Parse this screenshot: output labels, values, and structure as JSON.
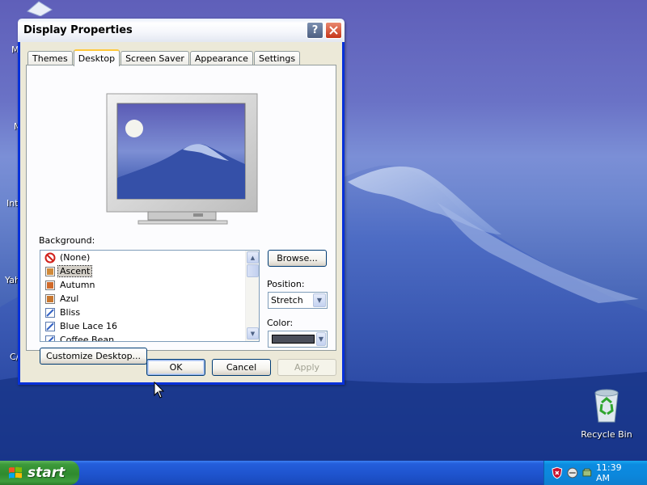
{
  "desktop": {
    "icons_partial": [
      "M",
      "M",
      "Int",
      "Yah",
      "C/"
    ],
    "recycle_bin_label": "Recycle Bin"
  },
  "taskbar": {
    "start_label": "start",
    "clock": "11:39 AM",
    "tray_icons": [
      "security-shield-icon",
      "network-icon",
      "safely-remove-hardware-icon"
    ]
  },
  "dialog": {
    "title": "Display Properties",
    "tabs": [
      "Themes",
      "Desktop",
      "Screen Saver",
      "Appearance",
      "Settings"
    ],
    "active_tab": "Desktop",
    "background_label": "Background:",
    "backgrounds": [
      {
        "label": "(None)",
        "icon": "none-icon"
      },
      {
        "label": "Ascent",
        "icon": "image-file-icon",
        "selected": true
      },
      {
        "label": "Autumn",
        "icon": "image-file-icon"
      },
      {
        "label": "Azul",
        "icon": "image-file-icon"
      },
      {
        "label": "Bliss",
        "icon": "bitmap-file-icon"
      },
      {
        "label": "Blue Lace 16",
        "icon": "bitmap-file-icon"
      },
      {
        "label": "Coffee Bean",
        "icon": "bitmap-file-icon"
      }
    ],
    "browse_label": "Browse...",
    "position_label": "Position:",
    "position_value": "Stretch",
    "color_label": "Color:",
    "color_value": "#4a4e5a",
    "customize_label": "Customize Desktop...",
    "ok_label": "OK",
    "cancel_label": "Cancel",
    "apply_label": "Apply"
  }
}
